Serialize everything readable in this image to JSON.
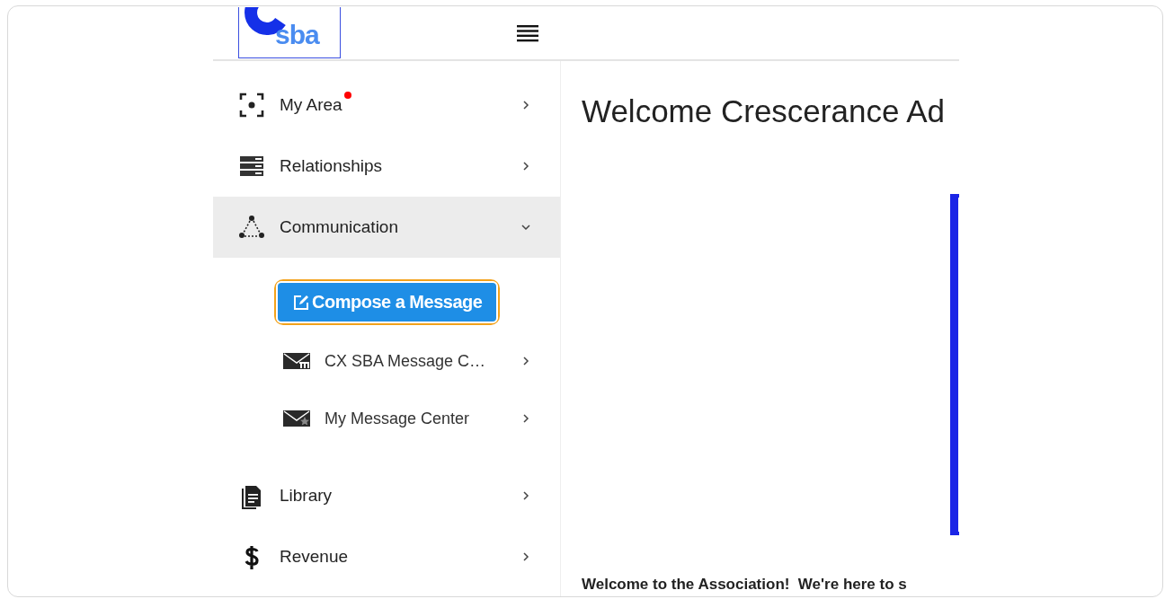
{
  "header": {
    "logo_text": "sba"
  },
  "sidebar": {
    "items": [
      {
        "label": "My Area",
        "notification_dot": true,
        "expanded": false,
        "selected": false
      },
      {
        "label": "Relationships",
        "notification_dot": false,
        "expanded": false,
        "selected": false
      },
      {
        "label": "Communication",
        "notification_dot": false,
        "expanded": true,
        "selected": true,
        "children": [
          {
            "kind": "button",
            "label": "Compose a Message",
            "focused": true
          },
          {
            "kind": "link",
            "label": "CX SBA Message C…"
          },
          {
            "kind": "link",
            "label": "My Message Center"
          }
        ]
      },
      {
        "label": "Library",
        "notification_dot": false,
        "expanded": false,
        "selected": false
      },
      {
        "label": "Revenue",
        "notification_dot": false,
        "expanded": false,
        "selected": false
      }
    ]
  },
  "main": {
    "heading": "Welcome Crescerance Ad",
    "intro": "Welcome to the Association!  We're here to s"
  }
}
